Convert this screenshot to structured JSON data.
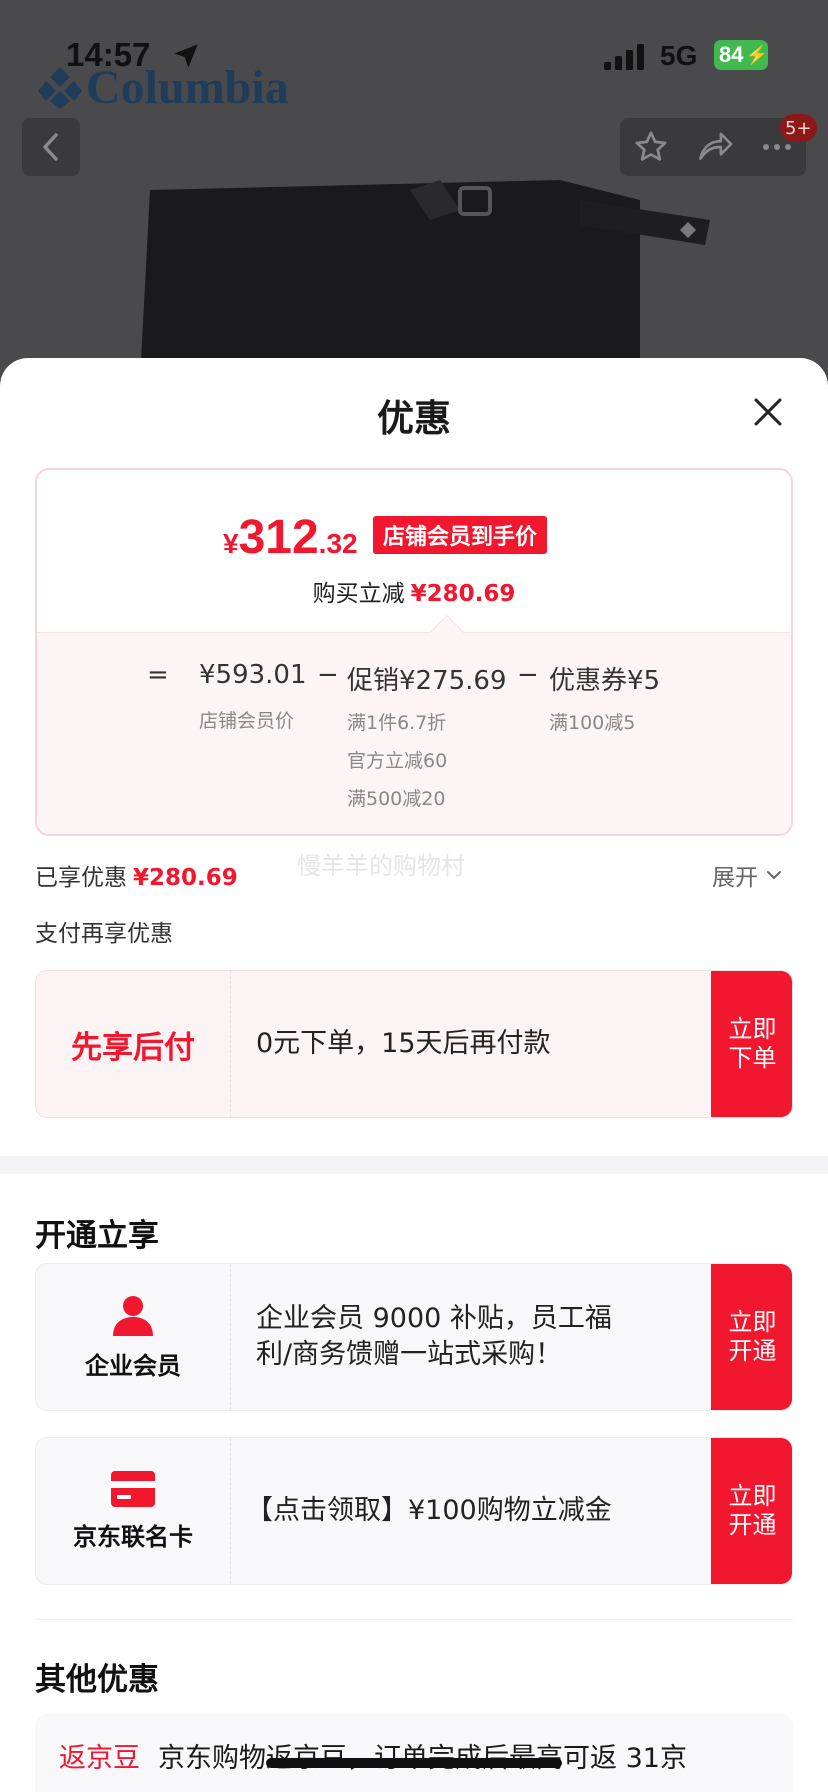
{
  "status_bar": {
    "time": "14:57",
    "network": "5G",
    "battery": "84"
  },
  "header": {
    "brand_logo": "Columbia",
    "notification_badge": "5+",
    "icons": [
      "back-icon",
      "star-icon",
      "share-icon",
      "more-icon"
    ]
  },
  "sheet": {
    "title": "优惠",
    "price_card": {
      "currency": "¥",
      "price_int": "312",
      "price_dec": ".32",
      "member_tag": "店铺会员到手价",
      "instant_label": "购买立减",
      "instant_amount": "¥280.69",
      "equals": "=",
      "base_price": "¥593.01",
      "base_label": "店铺会员价",
      "minus1": "−",
      "promo": "促销¥275.69",
      "promo_details": [
        "满1件6.7折",
        "官方立减60",
        "满500减20"
      ],
      "minus2": "−",
      "coupon": "优惠券¥5",
      "coupon_detail": "满100减5"
    },
    "enjoyed_label": "已享优惠",
    "enjoyed_amount": "¥280.69",
    "watermark": "慢羊羊的购物村",
    "expand_label": "展开",
    "pay_more_label": "支付再享优惠",
    "pay_later": {
      "title": "先享后付",
      "text": "0元下单，15天后再付款",
      "button": "立即下单"
    },
    "open_section_title": "开通立享",
    "enterprise": {
      "label": "企业会员",
      "text": "企业会员 9000 补贴，员工福利/商务馈赠一站式采购！",
      "button": "立即开通"
    },
    "card": {
      "label": "京东联名卡",
      "text": "【点击领取】¥100购物立减金",
      "button": "立即开通"
    },
    "other_section_title": "其他优惠",
    "other": {
      "tag": "返京豆",
      "text": "京东购物返京豆，订单完成后最高可返 31京"
    }
  },
  "colors": {
    "accent": "#f0172f",
    "battery": "#3fb950"
  }
}
